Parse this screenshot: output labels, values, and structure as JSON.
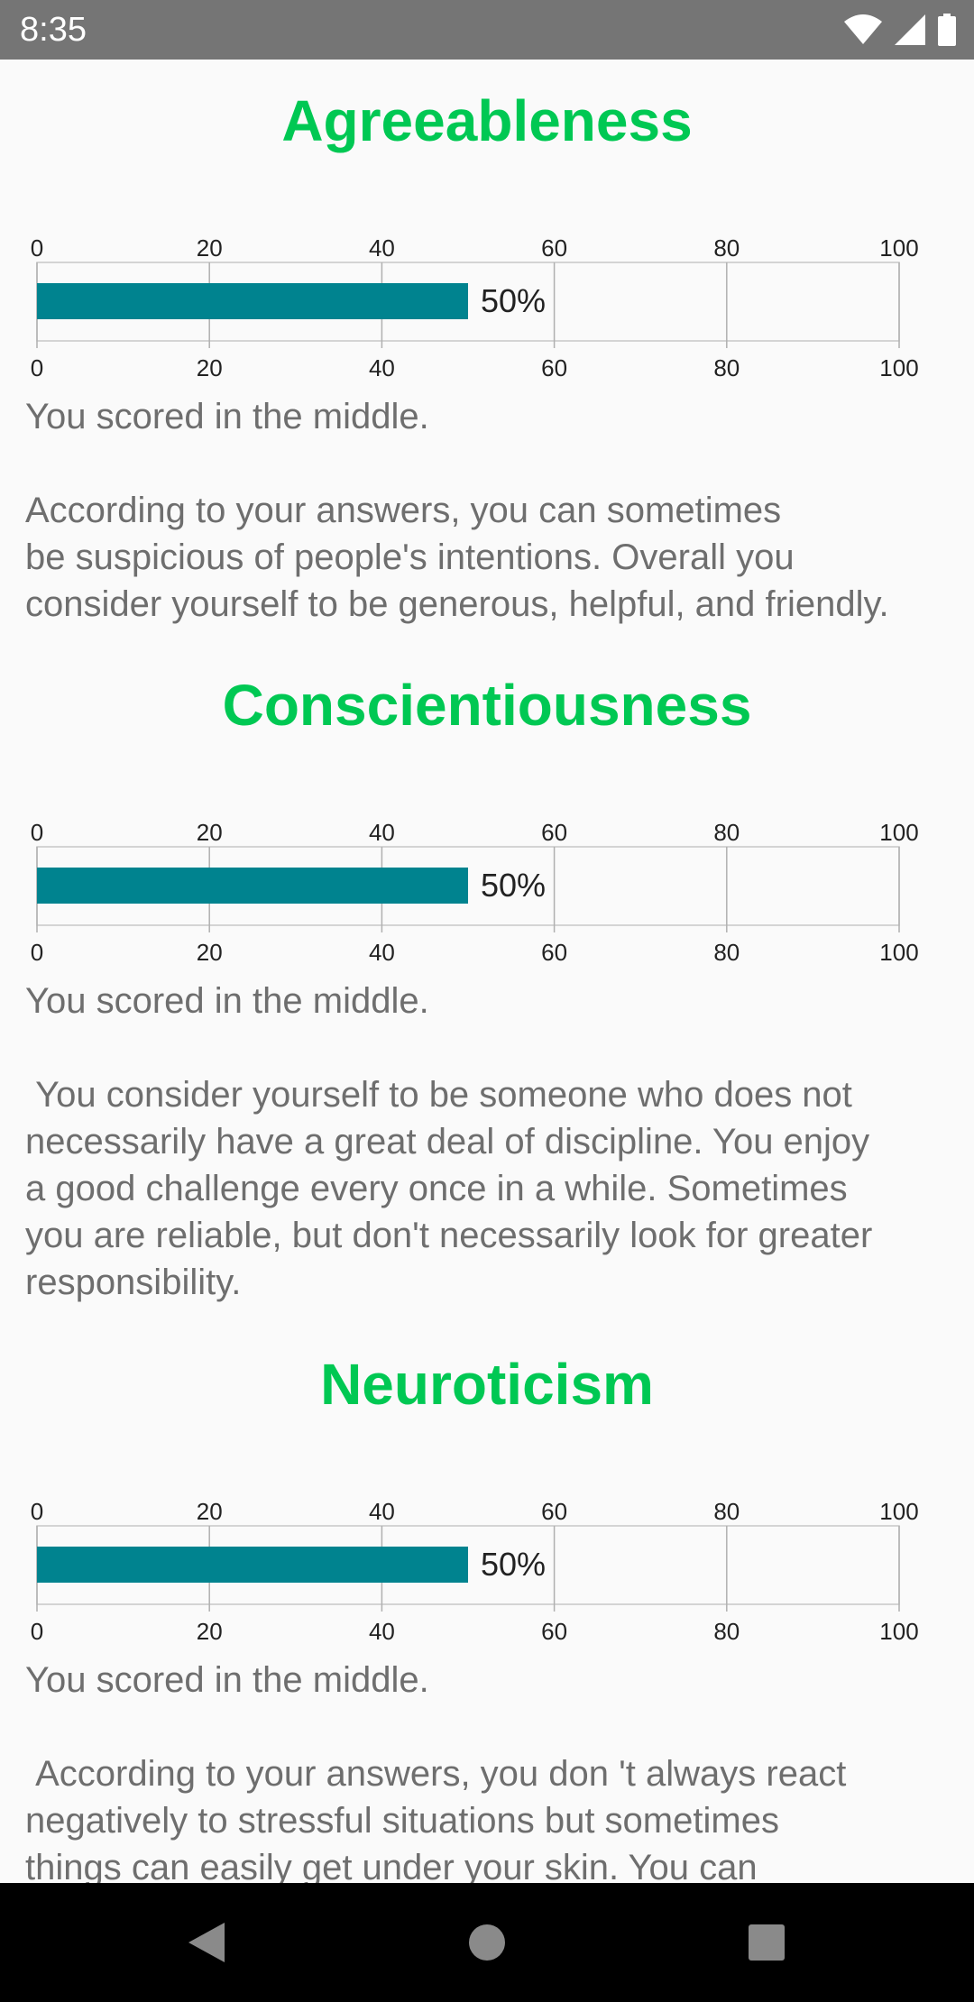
{
  "status_bar": {
    "time": "8:35"
  },
  "sections": [
    {
      "title": "Agreeableness",
      "score_percent": 50,
      "score_label": "50%",
      "result": "You scored in the middle.",
      "description": "According to your answers, you can sometimes\nbe suspicious of people's intentions. Overall you\nconsider yourself to be generous, helpful, and friendly."
    },
    {
      "title": "Conscientiousness",
      "score_percent": 50,
      "score_label": "50%",
      "result": "You scored in the middle.",
      "description": " You consider yourself to be someone who does not\nnecessarily have a great deal of discipline. You enjoy\na good challenge every once in a while. Sometimes\nyou are reliable, but don't necessarily look for greater\nresponsibility."
    },
    {
      "title": "Neuroticism",
      "score_percent": 50,
      "score_label": "50%",
      "result": "You scored in the middle.",
      "description": " According to your answers, you don 't always react\nnegatively to stressful situations but sometimes\nthings can easily get under your skin. You can"
    }
  ],
  "chart_data": [
    {
      "type": "bar",
      "categories": [
        ""
      ],
      "values": [
        50
      ],
      "data_labels": [
        "50%"
      ],
      "xlim": [
        0,
        100
      ],
      "ticks": [
        "0",
        "20",
        "40",
        "60",
        "80",
        "100"
      ],
      "bar_color": "#00838f",
      "orientation": "horizontal"
    },
    {
      "type": "bar",
      "categories": [
        ""
      ],
      "values": [
        50
      ],
      "data_labels": [
        "50%"
      ],
      "xlim": [
        0,
        100
      ],
      "ticks": [
        "0",
        "20",
        "40",
        "60",
        "80",
        "100"
      ],
      "bar_color": "#00838f",
      "orientation": "horizontal"
    },
    {
      "type": "bar",
      "categories": [
        ""
      ],
      "values": [
        50
      ],
      "data_labels": [
        "50%"
      ],
      "xlim": [
        0,
        100
      ],
      "ticks": [
        "0",
        "20",
        "40",
        "60",
        "80",
        "100"
      ],
      "bar_color": "#00838f",
      "orientation": "horizontal"
    }
  ],
  "colors": {
    "title": "#00c853",
    "bar": "#00838f",
    "body_text": "#6e6e6e",
    "status_bar": "#757575",
    "nav_bar": "#000000",
    "background": "#fafafa"
  },
  "icons": {
    "status": [
      "wifi-icon",
      "cellular-signal-icon",
      "battery-icon"
    ],
    "nav": [
      "back-icon",
      "home-icon",
      "recents-icon"
    ]
  }
}
